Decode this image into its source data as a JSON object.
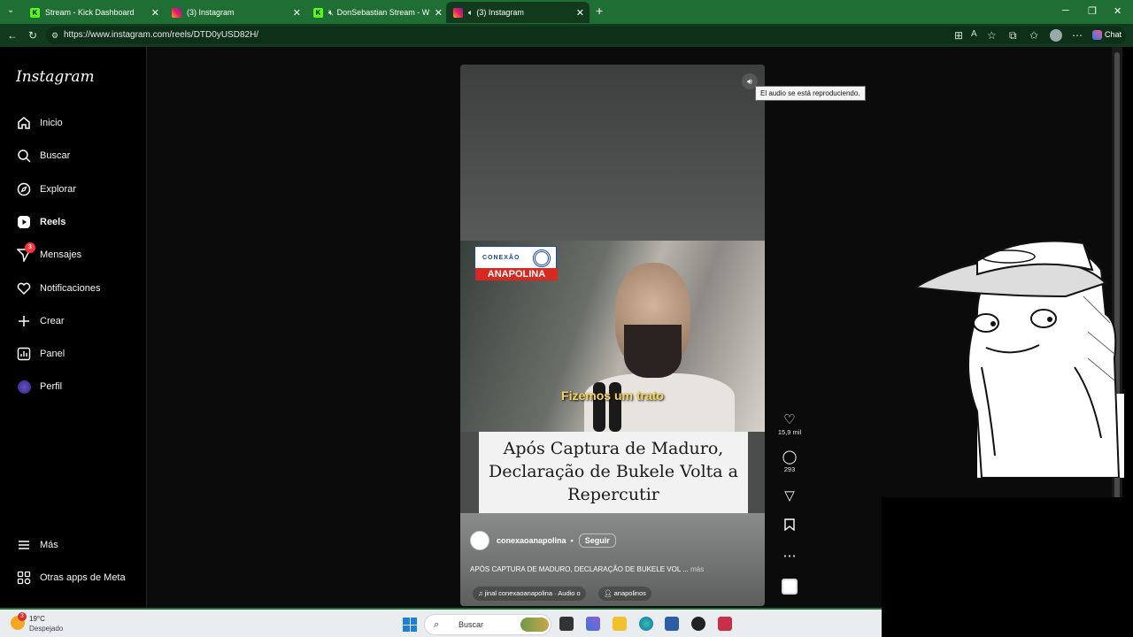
{
  "browser": {
    "tabs": [
      {
        "label": "Stream - Kick Dashboard",
        "icon": "kick-icon"
      },
      {
        "label": "(3) Instagram",
        "icon": "instagram-icon"
      },
      {
        "label": "DonSebastian Stream - Watch",
        "icon": "kick-icon"
      },
      {
        "label": "(3) Instagram",
        "icon": "instagram-icon"
      }
    ],
    "url": "https://www.instagram.com/reels/DTD0yUSD82H/",
    "chat_label": "Chat"
  },
  "sidebar": {
    "logo": "Instagram",
    "items": [
      {
        "label": "Inicio",
        "icon": "home-icon"
      },
      {
        "label": "Buscar",
        "icon": "search-icon"
      },
      {
        "label": "Explorar",
        "icon": "compass-icon"
      },
      {
        "label": "Reels",
        "icon": "reels-icon"
      },
      {
        "label": "Mensajes",
        "icon": "messenger-icon",
        "badge": "3"
      },
      {
        "label": "Notificaciones",
        "icon": "heart-icon"
      },
      {
        "label": "Crear",
        "icon": "plus-icon"
      },
      {
        "label": "Panel",
        "icon": "chart-icon"
      },
      {
        "label": "Perfil",
        "icon": "profile-avatar"
      }
    ],
    "more": "Más",
    "meta_apps": "Otras apps de Meta"
  },
  "reel": {
    "brand_top": "CONEXÃO",
    "brand_bottom": "ANAPOLINA",
    "subtitle": "Fizemos um trato",
    "headline": "Após Captura de Maduro, Declaração de Bukele Volta a Repercutir",
    "account": "conexaoanapolina",
    "separator": "•",
    "follow": "Seguir",
    "description": "APÓS CAPTURA DE MADURO, DECLARAÇÃO DE BUKELE VOL ...",
    "more": "más",
    "audio": "♫ jinal   conexaoanapolina · Audio o",
    "tag": "anapolinos",
    "tooltip": "El audio se está reproduciendo."
  },
  "actions": {
    "likes": "15,9 mil",
    "comments": "293"
  },
  "taskbar": {
    "temperature": "19°C",
    "condition": "Despejado",
    "weather_badge": "3",
    "search_placeholder": "Buscar"
  }
}
